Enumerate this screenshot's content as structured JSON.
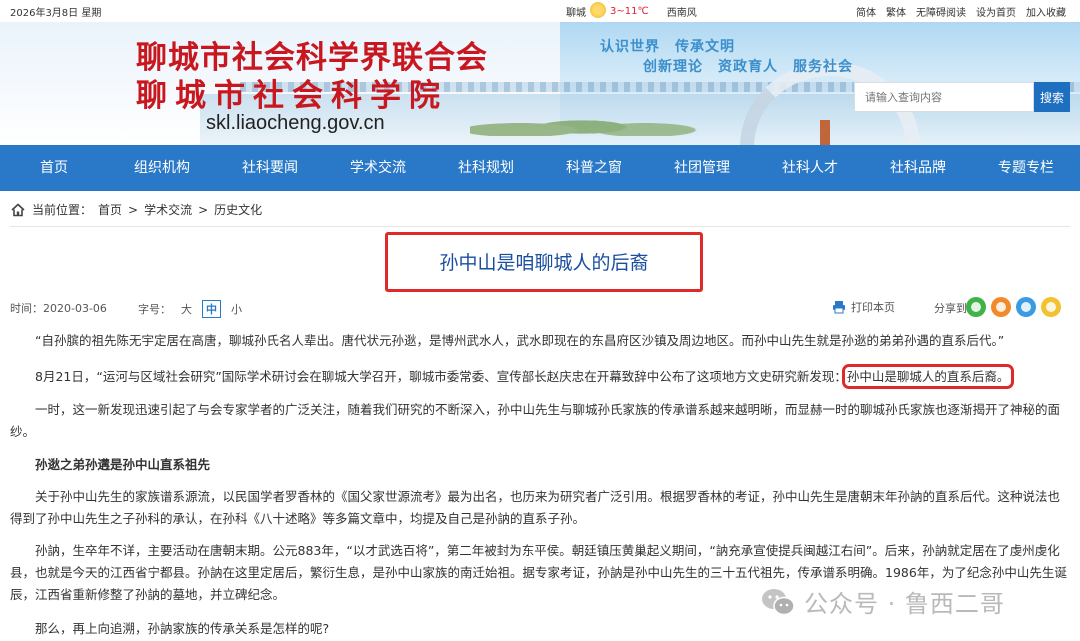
{
  "topbar": {
    "date": "2026年3月8日 星期",
    "city": "聊城",
    "temp": "3~11℃",
    "wind": "西南风",
    "links": [
      "简体",
      "繁体",
      "无障碍阅读",
      "设为首页",
      "加入收藏"
    ]
  },
  "banner": {
    "title1": "聊城市社会科学界联合会",
    "title2": "聊城市社会科学院",
    "domain": "skl.liaocheng.gov.cn",
    "slogan1": "认识世界　传承文明",
    "slogan2": "创新理论　资政育人　服务社会",
    "search_placeholder": "请输入查询内容",
    "search_button": "搜索"
  },
  "nav": [
    "首页",
    "组织机构",
    "社科要闻",
    "学术交流",
    "社科规划",
    "科普之窗",
    "社团管理",
    "社科人才",
    "社科品牌",
    "专题专栏"
  ],
  "breadcrumb": {
    "label": "当前位置：",
    "items": [
      "首页",
      "学术交流",
      "历史文化"
    ],
    "sep": ">"
  },
  "article": {
    "title": "孙中山是咱聊城人的后裔",
    "time_label": "时间：",
    "time": "2020-03-06",
    "fontsize_label": "字号：",
    "fontsize_opts": [
      "大",
      "中",
      "小"
    ],
    "print": "打印本页",
    "share": "分享到：",
    "share_icons": [
      "wechat-icon",
      "weibo-icon",
      "qq-icon",
      "qzone-icon"
    ],
    "p1": "“自孙膑的祖先陈无宇定居在高唐，聊城孙氏名人辈出。唐代状元孙逖，是博州武水人，武水即现在的东昌府区沙镇及周边地区。而孙中山先生就是孙逖的弟弟孙遇的直系后代。”",
    "p2a": "8月21日，“运河与区域社会研究”国际学术研讨会在聊城大学召开，聊城市委常委、宣传部长赵庆忠在开幕致辞中公布了这项地方文史研究新发现：",
    "p2b": "孙中山是聊城人的直系后裔。",
    "p3": "一时，这一新发现迅速引起了与会专家学者的广泛关注，随着我们研究的不断深入，孙中山先生与聊城孙氏家族的传承谱系越来越明晰，而显赫一时的聊城孙氏家族也逐渐揭开了神秘的面纱。",
    "p4": "孙逖之弟孙遘是孙中山直系祖先",
    "p5": "关于孙中山先生的家族谱系源流，以民国学者罗香林的《国父家世源流考》最为出名，也历来为研究者广泛引用。根据罗香林的考证，孙中山先生是唐朝末年孙訥的直系后代。这种说法也得到了孙中山先生之子孙科的承认，在孙科《八十述略》等多篇文章中，均提及自己是孙訥的直系子孙。",
    "p6": "孙訥，生卒年不详，主要活动在唐朝末期。公元883年，“以才武选百将”，第二年被封为东平侯。朝廷镇压黄巢起义期间，“訥充承宣使提兵闽越江右间”。后来，孙訥就定居在了虔州虔化县，也就是今天的江西省宁都县。孙訥在这里定居后，繁衍生息，是孙中山家族的南迁始祖。据专家考证，孙訥是孙中山先生的三十五代祖先，传承谱系明确。1986年，为了纪念孙中山先生诞辰，江西省重新修整了孙訥的墓地，并立碑纪念。",
    "p7": "那么，再上向追溯，孙訥家族的传承关系是怎样的呢?"
  },
  "watermark": {
    "text": "公众号 · 鲁西二哥"
  },
  "colors": {
    "nav_bg": "#2a79c8",
    "title_red": "#c8171e",
    "article_title": "#1a4fa0",
    "highlight_border": "#e02a2a"
  }
}
